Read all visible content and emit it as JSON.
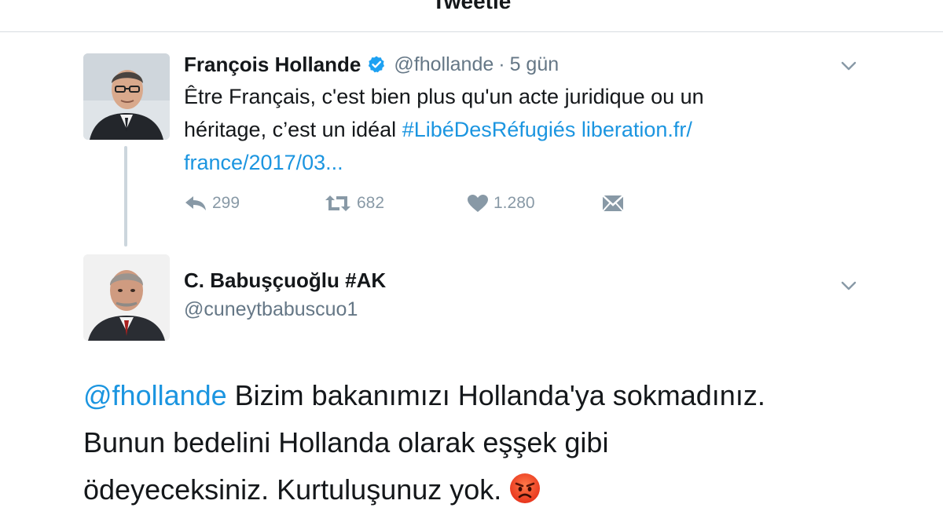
{
  "nav": {
    "title": "Tweetle"
  },
  "tweet1": {
    "display_name": "François Hollande",
    "verified": true,
    "handle": "@fhollande",
    "separator": "·",
    "time": "5 gün",
    "body": {
      "line1": "Être Français, c'est bien plus qu'un acte juridique ou un",
      "line2_text": "héritage, c’est un idéal ",
      "hashtag": "#LibéDesRéfugiés",
      "link_part1": "liberation.fr/",
      "link_part2": "france/2017/03..."
    },
    "actions": {
      "reply_count": "299",
      "retweet_count": "682",
      "like_count": "1.280"
    },
    "avatar_icon": "person-photo-icon"
  },
  "tweet2": {
    "display_name": "C. Babuşçuoğlu #AK",
    "handle": "@cuneytbabuscuo1",
    "body": {
      "mention": "@fhollande",
      "line1_text": " Bizim bakanımızı Hollanda'ya sokmadınız.",
      "line2": "Bunun bedelini Hollanda olarak eşşek gibi",
      "line3": "ödeyeceksiniz. Kurtuluşunuz yok.",
      "emoji": "angry-face-emoji"
    },
    "avatar_icon": "person-photo-icon"
  },
  "colors": {
    "link": "#1b95e0",
    "secondary_text": "#657786",
    "action_icon": "#8899a6",
    "thread_line": "#ccd6dd",
    "verified": "#1da1f2"
  }
}
